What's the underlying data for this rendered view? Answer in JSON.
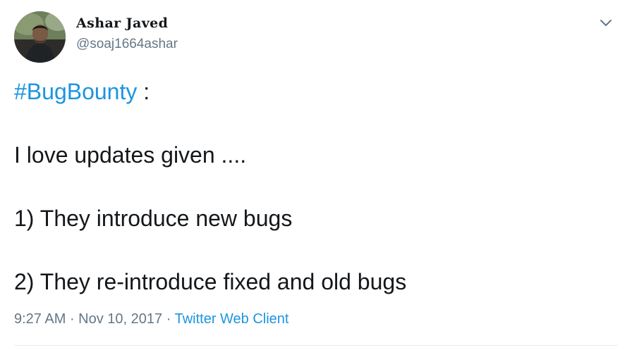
{
  "user": {
    "name": "Ashar Javed",
    "handle": "@soaj1664ashar"
  },
  "tweet": {
    "hashtag": "#BugBounty",
    "hashtag_suffix": " :",
    "line_1": "I love updates given ....",
    "line_2": "1) They introduce new bugs",
    "line_3": "2) They re-introduce fixed and old bugs"
  },
  "meta": {
    "time": "9:27 AM",
    "separator_1": " · ",
    "date": "Nov 10, 2017",
    "separator_2": " · ",
    "source": "Twitter Web Client"
  },
  "icons": {
    "menu": "chevron-down-icon"
  },
  "colors": {
    "link": "#1b95e0",
    "secondary_text": "#657786",
    "primary_text": "#14171a",
    "divider": "#e6ecf0"
  }
}
